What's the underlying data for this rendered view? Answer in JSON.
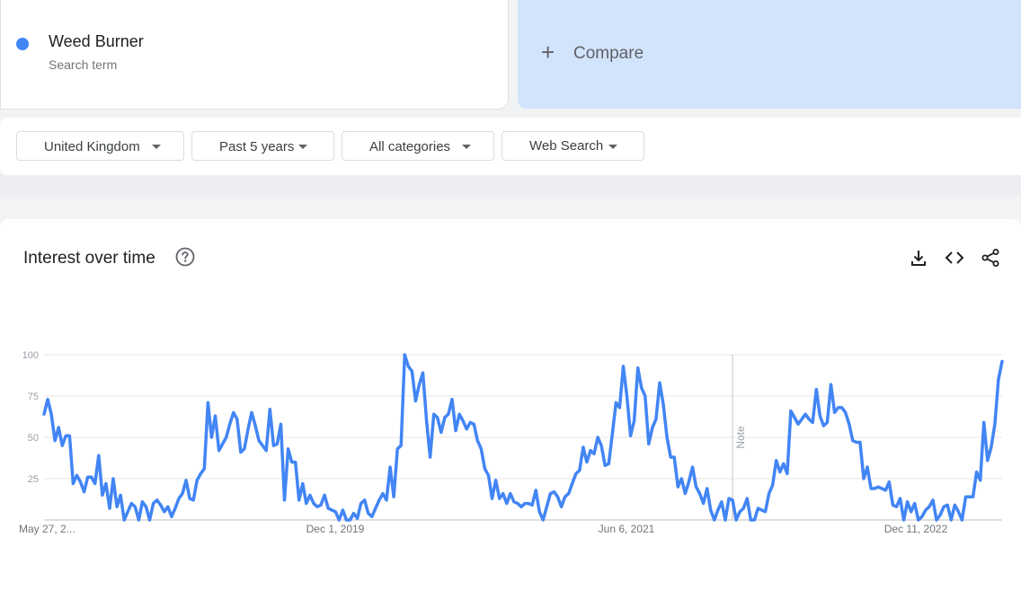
{
  "search_term": {
    "name": "Weed Burner",
    "subtitle": "Search term",
    "color": "#4285f4"
  },
  "compare": {
    "label": "Compare",
    "icon": "plus-icon"
  },
  "filters": [
    {
      "label": "United Kingdom"
    },
    {
      "label": "Past 5 years"
    },
    {
      "label": "All categories"
    },
    {
      "label": "Web Search"
    }
  ],
  "chart_section": {
    "title": "Interest over time",
    "icons": [
      "help-icon",
      "download-icon",
      "embed-code-icon",
      "share-icon"
    ]
  },
  "chart_data": {
    "type": "line",
    "x_tick_labels": [
      "May 27, 2...",
      "Dec 1, 2019",
      "Jun 6, 2021",
      "Dec 11, 2022"
    ],
    "y_ticks": [
      25,
      50,
      75,
      100
    ],
    "ylim": [
      0,
      100
    ],
    "grid": true,
    "annotation": {
      "label": "Note",
      "week_index": 189
    },
    "series": [
      {
        "color": "#4285f4",
        "values": [
          64,
          73,
          64,
          48,
          56,
          45,
          51,
          51,
          22,
          27,
          23,
          17,
          26,
          26,
          22,
          39,
          15,
          22,
          7,
          25,
          8,
          15,
          0,
          5,
          10,
          8,
          0,
          11,
          8,
          0,
          10,
          12,
          9,
          5,
          8,
          2,
          7,
          13,
          16,
          24,
          13,
          12,
          24,
          28,
          31,
          71,
          50,
          63,
          42,
          46,
          50,
          58,
          65,
          61,
          41,
          43,
          55,
          65,
          57,
          48,
          45,
          42,
          67,
          45,
          46,
          58,
          12,
          43,
          35,
          35,
          12,
          22,
          10,
          15,
          10,
          8,
          9,
          15,
          7,
          6,
          5,
          0,
          6,
          0,
          0,
          4,
          1,
          10,
          12,
          4,
          2,
          7,
          12,
          16,
          12,
          32,
          14,
          43,
          45,
          100,
          93,
          90,
          72,
          82,
          89,
          60,
          38,
          64,
          62,
          53,
          62,
          64,
          73,
          54,
          64,
          60,
          55,
          59,
          58,
          48,
          43,
          31,
          27,
          13,
          24,
          13,
          16,
          10,
          16,
          11,
          10,
          8,
          10,
          10,
          9,
          18,
          5,
          0,
          8,
          16,
          17,
          14,
          8,
          14,
          16,
          22,
          28,
          30,
          44,
          35,
          42,
          40,
          50,
          45,
          33,
          34,
          52,
          71,
          68,
          93,
          75,
          51,
          60,
          92,
          80,
          75,
          46,
          56,
          61,
          83,
          70,
          50,
          38,
          38,
          20,
          25,
          16,
          23,
          32,
          20,
          16,
          10,
          19,
          6,
          0,
          6,
          11,
          0,
          13,
          12,
          0,
          5,
          7,
          13,
          0,
          0,
          7,
          6,
          5,
          16,
          21,
          36,
          29,
          34,
          28,
          66,
          62,
          58,
          61,
          64,
          61,
          59,
          79,
          63,
          57,
          59,
          82,
          65,
          68,
          68,
          65,
          58,
          48,
          47,
          47,
          25,
          32,
          19,
          19,
          20,
          19,
          18,
          23,
          9,
          8,
          13,
          0,
          11,
          5,
          10,
          0,
          2,
          6,
          8,
          12,
          0,
          3,
          8,
          9,
          0,
          9,
          5,
          0,
          14,
          14,
          14,
          29,
          24,
          59,
          36,
          44,
          58,
          85,
          96
        ]
      }
    ]
  }
}
